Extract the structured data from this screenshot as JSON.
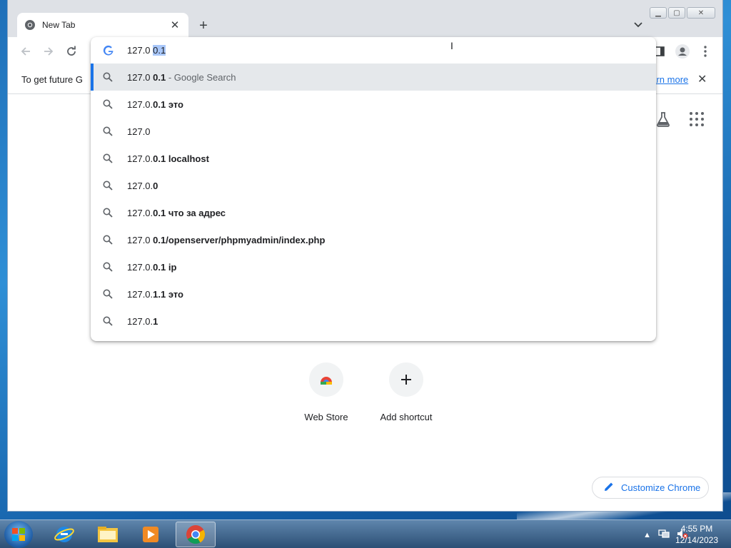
{
  "browser": {
    "tab": {
      "title": "New Tab",
      "favicon": "chrome-icon",
      "close_label": "✕"
    },
    "new_tab_label": "+",
    "window_controls": [
      "minimize",
      "maximize",
      "close"
    ]
  },
  "infobar": {
    "message": "To get future G",
    "link": "earn more",
    "close": "✕"
  },
  "omnibox": {
    "typed": "127.0 ",
    "selected": "0.1",
    "suggestions": [
      {
        "plain": "127.0 ",
        "bold": "0.1",
        "hint": " - Google Search"
      },
      {
        "plain": "127.0.",
        "bold": "0.1 это",
        "hint": ""
      },
      {
        "plain": "127.0",
        "bold": "",
        "hint": ""
      },
      {
        "plain": "127.0.",
        "bold": "0.1 localhost",
        "hint": ""
      },
      {
        "plain": "127.0.",
        "bold": "0",
        "hint": ""
      },
      {
        "plain": "127.0.",
        "bold": "0.1 что за адрес",
        "hint": ""
      },
      {
        "plain": "127.0 ",
        "bold": "0.1/openserver/phpmyadmin/index.php",
        "hint": ""
      },
      {
        "plain": "127.0.",
        "bold": "0.1 ip",
        "hint": ""
      },
      {
        "plain": "127.0.",
        "bold": "1.1 это",
        "hint": ""
      },
      {
        "plain": "127.0.",
        "bold": "1",
        "hint": ""
      }
    ]
  },
  "shortcuts": [
    {
      "label": "Web Store",
      "icon": "web-store-icon"
    },
    {
      "label": "Add shortcut",
      "icon": "plus-icon"
    }
  ],
  "customize": {
    "label": "Customize Chrome"
  },
  "taskbar": {
    "apps": [
      "internet-explorer-icon",
      "explorer-icon",
      "media-player-icon",
      "chrome-icon"
    ],
    "time": "4:55 PM",
    "date": "12/14/2023"
  },
  "colors": {
    "accent": "#1a73e8",
    "suggestion_highlight": "#e5e8eb"
  }
}
